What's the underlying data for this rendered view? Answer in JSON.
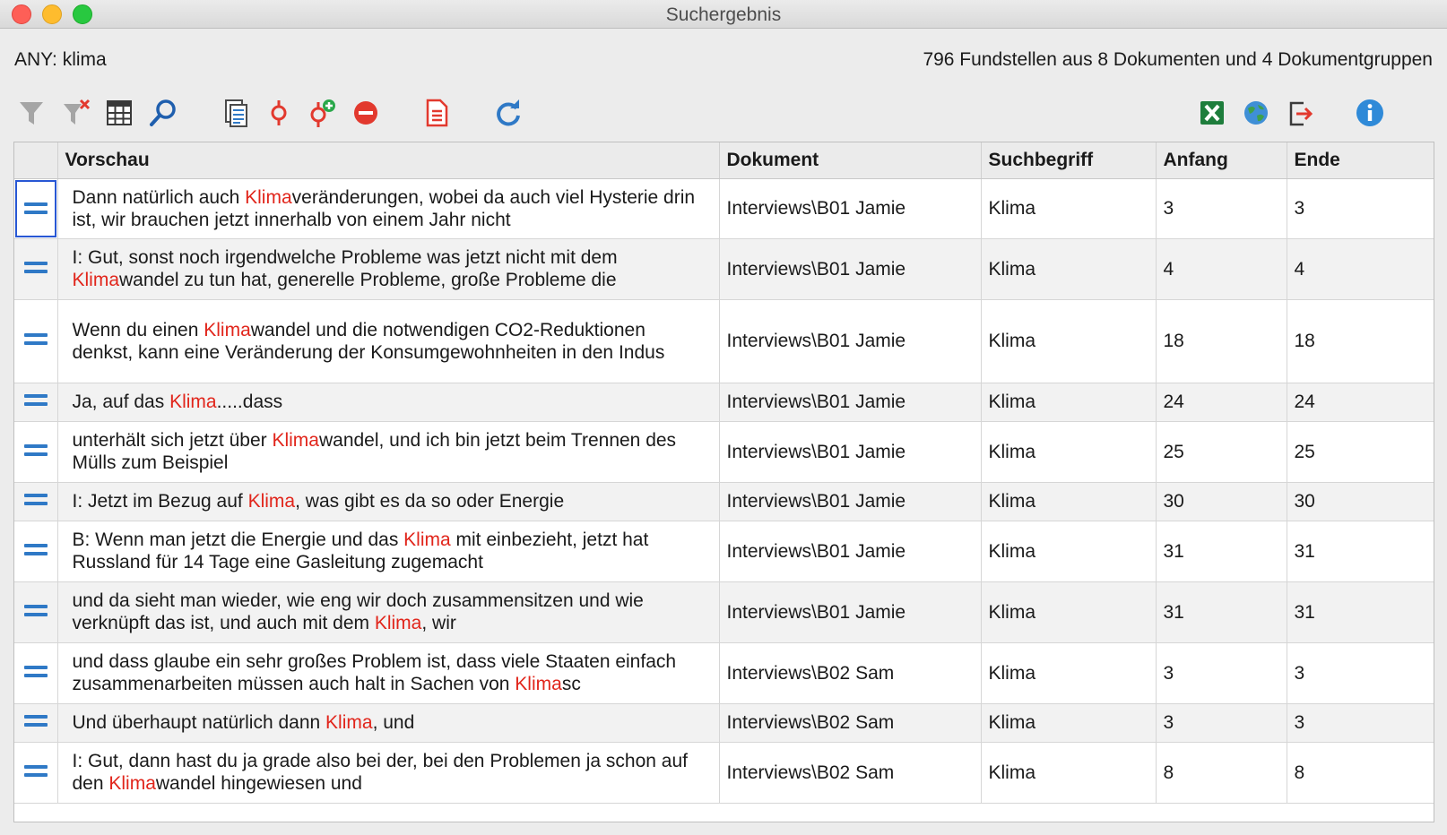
{
  "window": {
    "title": "Suchergebnis"
  },
  "header": {
    "query": "ANY: klima",
    "summary": "796 Fundstellen aus 8 Dokumenten und 4 Dokumentgruppen"
  },
  "toolbar": {
    "left_icons": [
      "filter-icon",
      "clear-filter-icon",
      "table-columns-icon",
      "search-icon",
      "document-list-icon",
      "code-icon",
      "add-code-icon",
      "remove-icon",
      "report-icon",
      "refresh-icon"
    ],
    "right_icons": [
      "excel-export-icon",
      "web-export-icon",
      "export-icon",
      "info-icon"
    ]
  },
  "colors": {
    "highlight": "#e1251b",
    "accent": "#2f79c6"
  },
  "table": {
    "columns": [
      "",
      "Vorschau",
      "Dokument",
      "Suchbegriff",
      "Anfang",
      "Ende"
    ],
    "rows": [
      {
        "pre": "Dann natürlich auch ",
        "hit": "Klima",
        "post": "veränderungen, wobei da auch viel Hysterie drin ist, wir brauchen jetzt innerhalb von einem Jahr nicht",
        "doc": "Interviews\\B01 Jamie",
        "term": "Klima",
        "start": "3",
        "end": "3"
      },
      {
        "pre": "I: Gut, sonst noch irgendwelche Probleme was jetzt nicht mit dem ",
        "hit": "Klima",
        "post": "wandel zu tun hat, generelle Probleme, große Probleme die",
        "doc": "Interviews\\B01 Jamie",
        "term": "Klima",
        "start": "4",
        "end": "4"
      },
      {
        "pre": "Wenn du einen ",
        "hit": "Klima",
        "post": "wandel und die notwendigen CO2-Reduktionen denkst, kann eine Veränderung der Konsumgewohnheiten in den Indus",
        "doc": "Interviews\\B01 Jamie",
        "term": "Klima",
        "start": "18",
        "end": "18"
      },
      {
        "pre": "Ja, auf das ",
        "hit": "Klima",
        "post": ".....dass",
        "doc": "Interviews\\B01 Jamie",
        "term": "Klima",
        "start": "24",
        "end": "24"
      },
      {
        "pre": "unterhält sich jetzt über ",
        "hit": "Klima",
        "post": "wandel, und ich bin jetzt beim Trennen des Mülls zum Beispiel",
        "doc": "Interviews\\B01 Jamie",
        "term": "Klima",
        "start": "25",
        "end": "25"
      },
      {
        "pre": "I: Jetzt im Bezug auf ",
        "hit": "Klima",
        "post": ", was gibt es da so oder Energie",
        "doc": "Interviews\\B01 Jamie",
        "term": "Klima",
        "start": "30",
        "end": "30"
      },
      {
        "pre": "B: Wenn man jetzt die Energie und das ",
        "hit": "Klima",
        "post": " mit einbezieht, jetzt hat Russland für 14 Tage eine Gasleitung zugemacht",
        "doc": "Interviews\\B01 Jamie",
        "term": "Klima",
        "start": "31",
        "end": "31"
      },
      {
        "pre": "und da sieht man wieder, wie eng wir doch zusammensitzen und wie verknüpft das ist, und auch mit dem ",
        "hit": "Klima",
        "post": ", wir",
        "doc": "Interviews\\B01 Jamie",
        "term": "Klima",
        "start": "31",
        "end": "31"
      },
      {
        "pre": "und dass glaube ein sehr großes Problem ist, dass viele Staaten einfach zusammenarbeiten müssen auch halt in Sachen von ",
        "hit": "Klima",
        "post": "sc",
        "doc": "Interviews\\B02 Sam",
        "term": "Klima",
        "start": "3",
        "end": "3"
      },
      {
        "pre": "Und überhaupt natürlich dann ",
        "hit": "Klima",
        "post": ", und",
        "doc": "Interviews\\B02 Sam",
        "term": "Klima",
        "start": "3",
        "end": "3"
      },
      {
        "pre": "I: Gut, dann hast du ja grade also bei der, bei den Problemen ja schon auf den ",
        "hit": "Klima",
        "post": "wandel hingewiesen und",
        "doc": "Interviews\\B02 Sam",
        "term": "Klima",
        "start": "8",
        "end": "8"
      }
    ]
  }
}
